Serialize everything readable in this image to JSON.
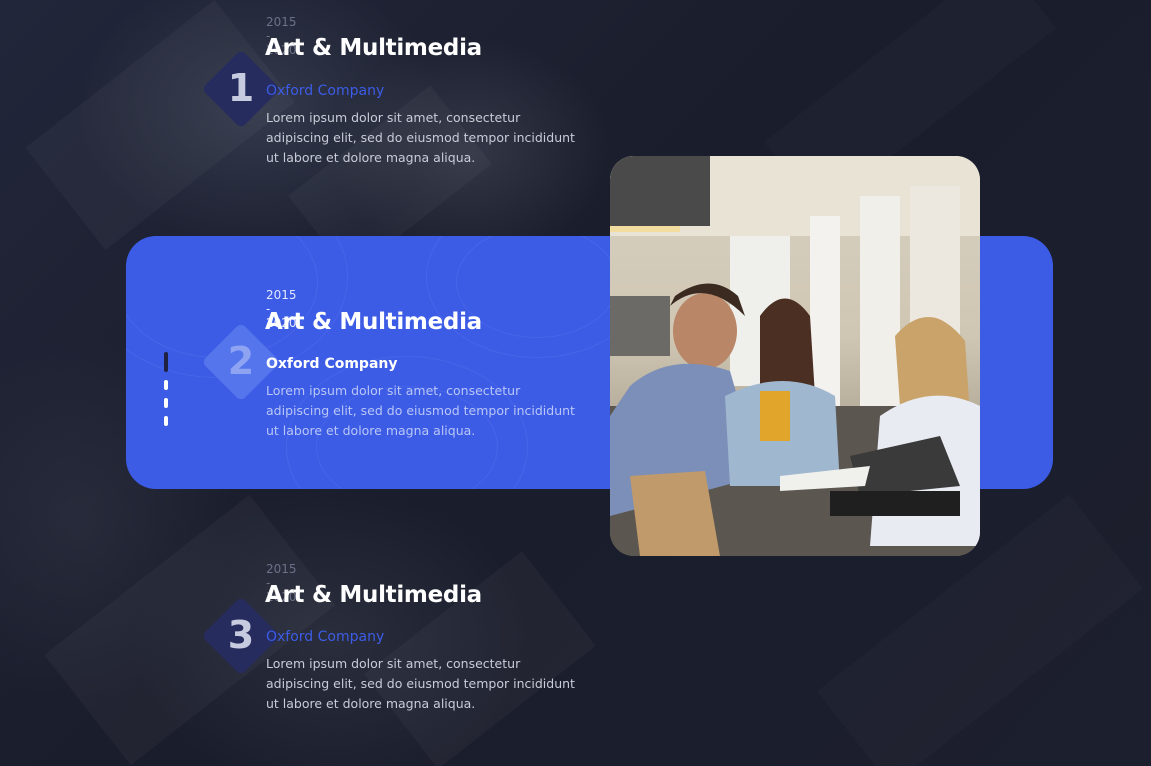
{
  "timeline": {
    "items": [
      {
        "number": "1",
        "years": "2015 - 2020",
        "title": "Art & Multimedia",
        "company": "Oxford Company",
        "description": "Lorem ipsum dolor sit amet, consectetur adipiscing elit, sed do eiusmod tempor incididunt ut labore et dolore magna aliqua."
      },
      {
        "number": "2",
        "years": "2015 - 2020",
        "title": "Art & Multimedia",
        "company": "Oxford Company",
        "description": "Lorem ipsum dolor sit amet, consectetur adipiscing elit, sed do eiusmod tempor incididunt ut labore et dolore magna aliqua."
      },
      {
        "number": "3",
        "years": "2015 - 2020",
        "title": "Art & Multimedia",
        "company": "Oxford Company",
        "description": "Lorem ipsum dolor sit amet, consectetur adipiscing elit, sed do eiusmod tempor incididunt ut labore et dolore magna aliqua."
      }
    ],
    "active_index": 2
  },
  "colors": {
    "background": "#1b1e2c",
    "accent": "#3c5ce6",
    "company_inactive": "#3c5ce6",
    "diamond_inactive": "#262c5e",
    "number_inactive": "#c7cbe0"
  }
}
